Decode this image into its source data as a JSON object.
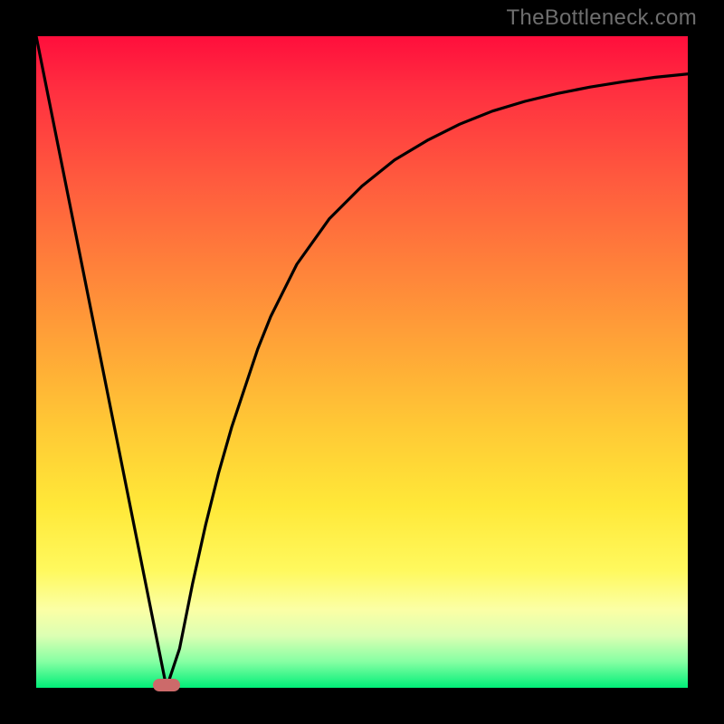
{
  "attribution": "TheBottleneck.com",
  "chart_data": {
    "type": "line",
    "title": "",
    "xlabel": "",
    "ylabel": "",
    "xlim": [
      0,
      100
    ],
    "ylim": [
      0,
      100
    ],
    "series": [
      {
        "name": "curve",
        "x": [
          0,
          2,
          4,
          6,
          8,
          10,
          12,
          14,
          16,
          18,
          20,
          22,
          24,
          26,
          28,
          30,
          32,
          34,
          36,
          38,
          40,
          45,
          50,
          55,
          60,
          65,
          70,
          75,
          80,
          85,
          90,
          95,
          100
        ],
        "y": [
          100,
          90,
          80,
          70,
          60,
          50,
          40,
          30,
          20,
          10,
          0,
          6,
          16,
          25,
          33,
          40,
          46,
          52,
          57,
          61,
          65,
          72,
          77,
          81,
          84,
          86.5,
          88.5,
          90,
          91.2,
          92.2,
          93,
          93.7,
          94.2
        ]
      }
    ],
    "marker": {
      "x": 20,
      "y": 0
    },
    "gradient_stops": [
      {
        "pos": 0,
        "color": "#ff0e3c"
      },
      {
        "pos": 22,
        "color": "#ff5a3e"
      },
      {
        "pos": 48,
        "color": "#ffa637"
      },
      {
        "pos": 72,
        "color": "#ffe838"
      },
      {
        "pos": 88,
        "color": "#fbffa5"
      },
      {
        "pos": 100,
        "color": "#00ee78"
      }
    ]
  }
}
